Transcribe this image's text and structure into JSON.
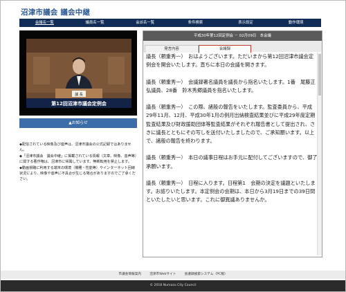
{
  "site": {
    "title": "沼津市議会 議会中継"
  },
  "nav": [
    {
      "label": "会議名一覧"
    },
    {
      "label": "議員名一覧"
    },
    {
      "label": "会派名一覧"
    },
    {
      "label": "条件検索"
    },
    {
      "label": "表示設定"
    },
    {
      "label": "動作環境"
    }
  ],
  "video": {
    "caption": "第12回沼津市議会定例会",
    "nameplate": "議 長"
  },
  "notice_button": "▲お知らせ",
  "disclaimer": [
    "◆配信されている映像及び音声は、沼津市議会の公式記録ではありません。",
    "◆「沼津市議会　議会中継」に掲載されている情報（文章、映像、音声等）に関する著作権は、沼津市に帰属しています。無断転用を禁止します。",
    "◆動画視聴に利用する端末の環境（機種・性能等）やインターネット回線状況により、映像や音声に不具合が生じる場合がありますのでご了承ください。"
  ],
  "session": {
    "header": "平成30年第12回定例会 － 02月09日　本会議"
  },
  "tabs": {
    "tab1": "発言内容",
    "tab2": "会議録"
  },
  "transcript": [
    "議長（頼重秀一）　おはようございます。ただいまから第12回沼津市議会定例会を開会いたします。直ちに本日の会議を開きます。",
    "議長（頼重秀一）　会議録署名議員を議長から指名いたします。1番　尾藤正弘議員、28番　鈴木秀郷議員を指名いたします。",
    "議長（頼重秀一）　この際、諸般の報告をいたします。監査委員から、平成29年11月、12月、平成30年1月の例月出納検査結果並びに平成29年度定期監査結果及び財政援助団体等監査結果がそれぞれ報告書として提出され、さきに議長とともにその写しを送付いたしましたので、ご承知願います。以上で、諸般の報告を終わります。",
    "議長（頼重秀一）　本日の議事日程はお手元に配付してございますので、御了承願います。",
    "議長（頼重秀一）　日程に入ります。日程第1　会期の決定を議題といたします。お諮りいたします。本定例会の会期は、本日から3月19日までの39日間といたしたいと思います。これに御異議ありませんか。"
  ],
  "footer": {
    "links": [
      "市議会情報案内",
      "沼津市Webサイト",
      "会議録検索システム（PC版）"
    ],
    "copyright": "© 2018 Numazu City Council"
  },
  "colors": {
    "nav_bg": "#0f2d57",
    "title": "#2f5a92",
    "notice_bg": "#3b6ea8",
    "active_tab": "#c0392b"
  }
}
